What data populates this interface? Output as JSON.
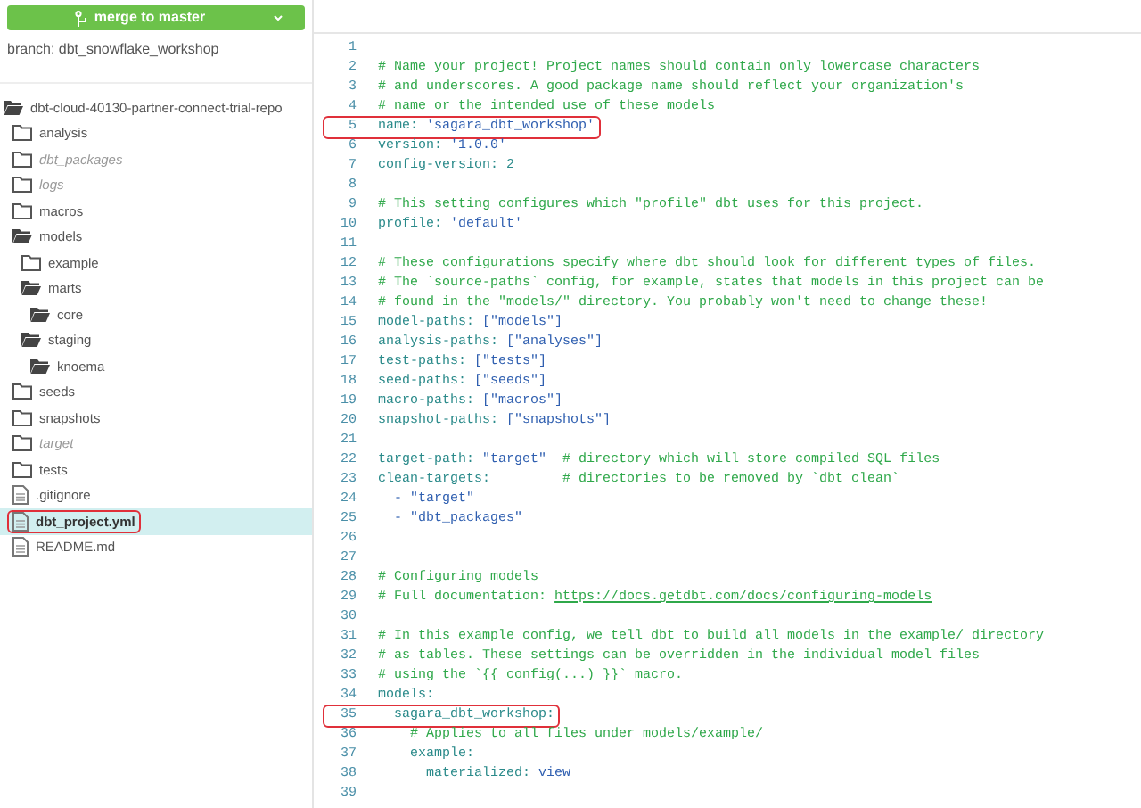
{
  "merge_button": {
    "label": "merge to master"
  },
  "branch": "branch: dbt_snowflake_workshop",
  "tree": [
    {
      "kind": "folder",
      "name": "dbt-cloud-40130-partner-connect-trial-repo",
      "expanded": true,
      "selected": false,
      "children": [
        {
          "kind": "folder",
          "name": "analysis",
          "expanded": false,
          "selected": false
        },
        {
          "kind": "folder",
          "name": "dbt_packages",
          "expanded": false,
          "ignored": true,
          "selected": false
        },
        {
          "kind": "folder",
          "name": "logs",
          "expanded": false,
          "ignored": true,
          "selected": false
        },
        {
          "kind": "folder",
          "name": "macros",
          "expanded": false,
          "selected": false
        },
        {
          "kind": "folder",
          "name": "models",
          "expanded": true,
          "selected": false,
          "children": [
            {
              "kind": "folder",
              "name": "example",
              "expanded": false,
              "selected": false
            },
            {
              "kind": "folder",
              "name": "marts",
              "expanded": true,
              "selected": false,
              "children": [
                {
                  "kind": "folder",
                  "name": "core",
                  "expanded": true,
                  "selected": false
                }
              ]
            },
            {
              "kind": "folder",
              "name": "staging",
              "expanded": true,
              "selected": false,
              "children": [
                {
                  "kind": "folder",
                  "name": "knoema",
                  "expanded": true,
                  "selected": false
                }
              ]
            }
          ]
        },
        {
          "kind": "folder",
          "name": "seeds",
          "expanded": false,
          "selected": false
        },
        {
          "kind": "folder",
          "name": "snapshots",
          "expanded": false,
          "selected": false
        },
        {
          "kind": "folder",
          "name": "target",
          "expanded": false,
          "ignored": true,
          "selected": false
        },
        {
          "kind": "folder",
          "name": "tests",
          "expanded": false,
          "selected": false
        },
        {
          "kind": "file",
          "name": ".gitignore",
          "selected": false
        },
        {
          "kind": "file",
          "name": "dbt_project.yml",
          "selected": true,
          "annotated": true
        },
        {
          "kind": "file",
          "name": "README.md",
          "selected": false
        }
      ]
    }
  ],
  "editor": {
    "lines": [
      {
        "number": "1"
      },
      {
        "number": "2",
        "segments": [
          {
            "kind": "comment",
            "text": "# Name your project! Project names should contain only lowercase characters"
          }
        ]
      },
      {
        "number": "3",
        "segments": [
          {
            "kind": "comment",
            "text": "# and underscores. A good package name should reflect your organization's"
          }
        ]
      },
      {
        "number": "4",
        "segments": [
          {
            "kind": "comment",
            "text": "# name or the intended use of these models"
          }
        ]
      },
      {
        "number": "5",
        "annotated": true,
        "segments": [
          {
            "kind": "key",
            "text": "name:"
          },
          {
            "kind": "string",
            "text": " 'sagara_dbt_workshop'"
          }
        ]
      },
      {
        "number": "6",
        "segments": [
          {
            "kind": "key",
            "text": "version:"
          },
          {
            "kind": "string",
            "text": " '1.0.0'"
          }
        ]
      },
      {
        "number": "7",
        "segments": [
          {
            "kind": "key",
            "text": "config-version:"
          },
          {
            "kind": "number",
            "text": " 2"
          }
        ]
      },
      {
        "number": "8"
      },
      {
        "number": "9",
        "segments": [
          {
            "kind": "comment",
            "text": "# This setting configures which \"profile\" dbt uses for this project."
          }
        ]
      },
      {
        "number": "10",
        "segments": [
          {
            "kind": "key",
            "text": "profile:"
          },
          {
            "kind": "string",
            "text": " 'default'"
          }
        ]
      },
      {
        "number": "11"
      },
      {
        "number": "12",
        "segments": [
          {
            "kind": "comment",
            "text": "# These configurations specify where dbt should look for different types of files."
          }
        ]
      },
      {
        "number": "13",
        "segments": [
          {
            "kind": "comment",
            "text": "# The `source-paths` config, for example, states that models in this project can be"
          }
        ]
      },
      {
        "number": "14",
        "segments": [
          {
            "kind": "comment",
            "text": "# found in the \"models/\" directory. You probably won't need to change these!"
          }
        ]
      },
      {
        "number": "15",
        "segments": [
          {
            "kind": "key",
            "text": "model-paths:"
          },
          {
            "kind": "string",
            "text": " [\"models\"]"
          }
        ]
      },
      {
        "number": "16",
        "segments": [
          {
            "kind": "key",
            "text": "analysis-paths:"
          },
          {
            "kind": "string",
            "text": " [\"analyses\"]"
          }
        ]
      },
      {
        "number": "17",
        "segments": [
          {
            "kind": "key",
            "text": "test-paths:"
          },
          {
            "kind": "string",
            "text": " [\"tests\"]"
          }
        ]
      },
      {
        "number": "18",
        "segments": [
          {
            "kind": "key",
            "text": "seed-paths:"
          },
          {
            "kind": "string",
            "text": " [\"seeds\"]"
          }
        ]
      },
      {
        "number": "19",
        "segments": [
          {
            "kind": "key",
            "text": "macro-paths:"
          },
          {
            "kind": "string",
            "text": " [\"macros\"]"
          }
        ]
      },
      {
        "number": "20",
        "segments": [
          {
            "kind": "key",
            "text": "snapshot-paths:"
          },
          {
            "kind": "string",
            "text": " [\"snapshots\"]"
          }
        ]
      },
      {
        "number": "21"
      },
      {
        "number": "22",
        "segments": [
          {
            "kind": "key",
            "text": "target-path:"
          },
          {
            "kind": "string",
            "text": " \"target\""
          },
          {
            "kind": "comment",
            "text": "  # directory which will store compiled SQL files"
          }
        ]
      },
      {
        "number": "23",
        "segments": [
          {
            "kind": "key",
            "text": "clean-targets:"
          },
          {
            "kind": "comment",
            "text": "         # directories to be removed by `dbt clean`"
          }
        ]
      },
      {
        "number": "24",
        "segments": [
          {
            "kind": "string",
            "text": "  - \"target\""
          }
        ]
      },
      {
        "number": "25",
        "segments": [
          {
            "kind": "string",
            "text": "  - \"dbt_packages\""
          }
        ]
      },
      {
        "number": "26"
      },
      {
        "number": "27"
      },
      {
        "number": "28",
        "segments": [
          {
            "kind": "comment",
            "text": "# Configuring models"
          }
        ]
      },
      {
        "number": "29",
        "segments": [
          {
            "kind": "comment",
            "text": "# Full documentation: "
          },
          {
            "kind": "link",
            "text": "https://docs.getdbt.com/docs/configuring-models"
          }
        ]
      },
      {
        "number": "30"
      },
      {
        "number": "31",
        "segments": [
          {
            "kind": "comment",
            "text": "# In this example config, we tell dbt to build all models in the example/ directory"
          }
        ]
      },
      {
        "number": "32",
        "segments": [
          {
            "kind": "comment",
            "text": "# as tables. These settings can be overridden in the individual model files"
          }
        ]
      },
      {
        "number": "33",
        "segments": [
          {
            "kind": "comment",
            "text": "# using the `{{ config(...) }}` macro."
          }
        ]
      },
      {
        "number": "34",
        "segments": [
          {
            "kind": "key",
            "text": "models:"
          }
        ]
      },
      {
        "number": "35",
        "annotated": true,
        "segments": [
          {
            "kind": "key",
            "text": "  sagara_dbt_workshop:"
          }
        ]
      },
      {
        "number": "36",
        "segments": [
          {
            "kind": "comment",
            "text": "    # Applies to all files under models/example/"
          }
        ]
      },
      {
        "number": "37",
        "segments": [
          {
            "kind": "key",
            "text": "    example:"
          }
        ]
      },
      {
        "number": "38",
        "segments": [
          {
            "kind": "key",
            "text": "      materialized:"
          },
          {
            "kind": "string",
            "text": " view"
          }
        ]
      },
      {
        "number": "39"
      }
    ]
  }
}
